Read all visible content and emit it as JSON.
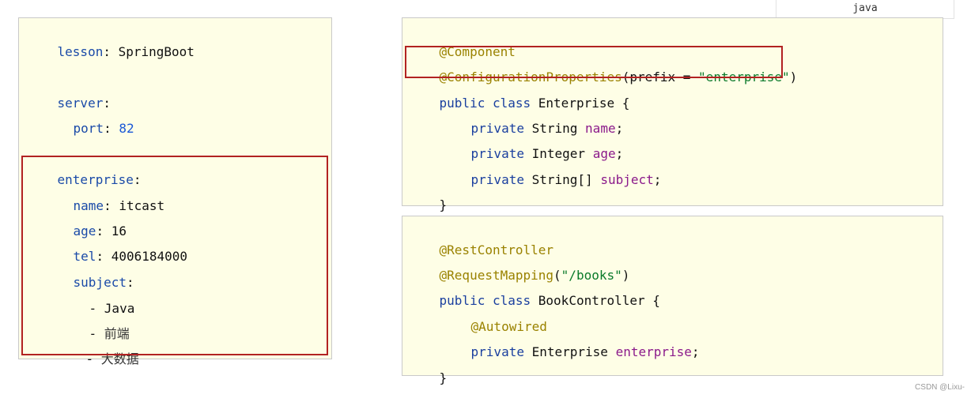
{
  "lang_tab": "java",
  "watermark": "CSDN @Lixu-",
  "yaml": {
    "lesson_key": "lesson",
    "lesson_val": "SpringBoot",
    "server_key": "server",
    "port_key": "port",
    "port_val": "82",
    "enterprise_key": "enterprise",
    "name_key": "name",
    "name_val": "itcast",
    "age_key": "age",
    "age_val": "16",
    "tel_key": "tel",
    "tel_val": "4006184000",
    "subject_key": "subject",
    "subject_items": [
      "Java",
      "前端",
      "大数据"
    ]
  },
  "enterprise_class": {
    "ann1": "@Component",
    "ann2": "@ConfigurationProperties",
    "ann2_prefix": "(prefix = ",
    "ann2_str": "\"enterprise\"",
    "ann2_close": ")",
    "kw_public": "public",
    "kw_class": "class",
    "class_decl": "Enterprise {",
    "kw_private": "private",
    "type_string": "String",
    "field_name": "name",
    "type_integer": "Integer",
    "field_age": "age",
    "type_string_arr": "String[]",
    "field_subject": "subject",
    "close": "}"
  },
  "controller_class": {
    "ann1": "@RestController",
    "ann2": "@RequestMapping",
    "ann2_open": "(",
    "ann2_str": "\"/books\"",
    "ann2_close": ")",
    "kw_public": "public",
    "kw_class": "class",
    "class_decl": "BookController {",
    "ann3": "@Autowired",
    "kw_private": "private",
    "type_enterprise": "Enterprise",
    "field_enterprise": "enterprise",
    "close": "}"
  }
}
